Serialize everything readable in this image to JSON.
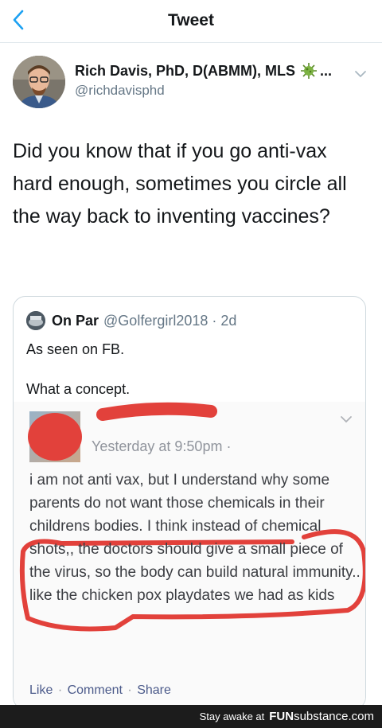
{
  "nav": {
    "title": "Tweet",
    "back_icon": "chevron-left-icon"
  },
  "tweet": {
    "author_name": "Rich Davis, PhD, D(ABMM), MLS",
    "name_icon": "virus-icon",
    "name_truncation": "...",
    "handle": "@richdavisphd",
    "text": "Did you know that if you go anti-vax hard enough, sometimes you circle all the way back to inventing vaccines?"
  },
  "quote": {
    "name": "On Par",
    "handle_and_time": "@Golfergirl2018 · 2d",
    "line1": "As seen on FB.",
    "line2": "What a concept."
  },
  "fb_post": {
    "timestamp": "Yesterday at 9:50pm ·",
    "body": "i am not anti vax, but I understand why some parents do not want those chemicals in their childrens bodies. I think instead of chemical shots,, the doctors should give a small piece of the virus, so the body can build natural immunity.. like the chicken pox playdates we had as kids",
    "actions": {
      "like": "Like",
      "comment": "Comment",
      "share": "Share",
      "separator": "·"
    }
  },
  "banner": {
    "text": "Stay awake at",
    "brand_bold": "FUN",
    "brand_light": "substance",
    "brand_suffix": ".com"
  },
  "colors": {
    "accent_blue": "#1da1f2",
    "secondary_text": "#657786",
    "annotation_red": "#e2413b"
  }
}
